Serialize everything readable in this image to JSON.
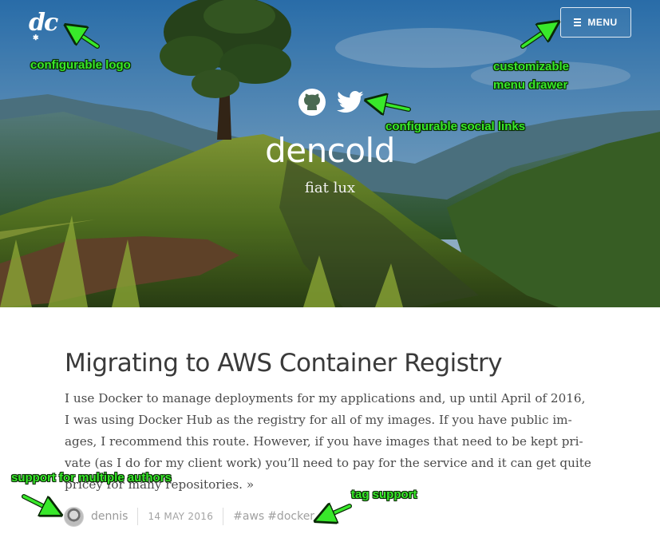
{
  "header": {
    "logo_text": "dc",
    "menu_label": "MENU",
    "site_title": "dencold",
    "tagline": "fiat lux",
    "social": [
      {
        "icon": "github-icon"
      },
      {
        "icon": "twitter-icon"
      }
    ]
  },
  "annotations": {
    "logo": "configurable logo",
    "menu_line1": "customizable",
    "menu_line2": "menu drawer",
    "social": "configurable social links",
    "authors": "support for multiple authors",
    "tags": "tag support",
    "color": "#38e82a"
  },
  "post": {
    "title": "Migrating to AWS Container Registry",
    "excerpt_lines": [
      "I use Docker to manage deployments for my applications and, up until April of 2016,",
      "I was using Docker Hub as the registry for all of my images. If you have public im-",
      "ages, I recommend this route. However, if you have images that need to be kept pri-",
      "vate (as I do for my client work) you’ll need to pay for the service and it can get quite",
      "pricey for many repositories."
    ],
    "more_link": "»",
    "author": "dennis",
    "date": "14 MAY 2016",
    "tags": [
      "#aws",
      "#docker"
    ]
  }
}
